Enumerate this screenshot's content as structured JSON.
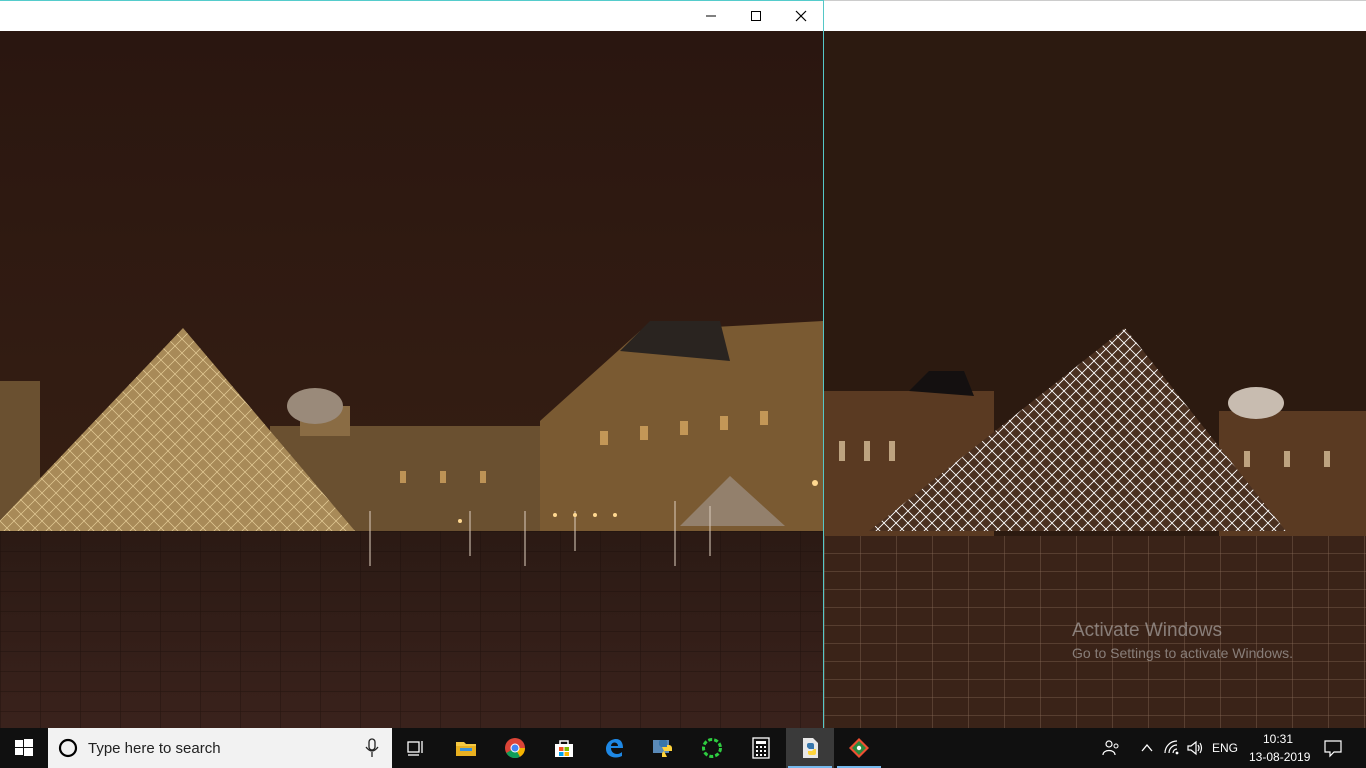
{
  "left_window": {
    "title": "",
    "controls": {
      "minimize": "minimize",
      "maximize": "maximize",
      "close": "close"
    }
  },
  "right_window": {
    "title": ""
  },
  "watermark": {
    "line1": "Activate Windows",
    "line2": "Go to Settings to activate Windows."
  },
  "taskbar": {
    "search_placeholder": "Type here to search",
    "pinned_apps": [
      {
        "name": "task-view-icon"
      },
      {
        "name": "file-explorer-icon"
      },
      {
        "name": "chrome-icon"
      },
      {
        "name": "store-icon"
      },
      {
        "name": "edge-icon"
      },
      {
        "name": "python-idle-icon"
      },
      {
        "name": "loading-app-icon"
      },
      {
        "name": "calculator-icon"
      },
      {
        "name": "python-running-icon"
      },
      {
        "name": "git-icon"
      }
    ],
    "tray": {
      "language": "ENG",
      "time": "10:31",
      "date": "13-08-2019"
    }
  },
  "colors": {
    "taskbar": "#101010",
    "sky": "#2a1610",
    "accent": "#76b9ed"
  }
}
